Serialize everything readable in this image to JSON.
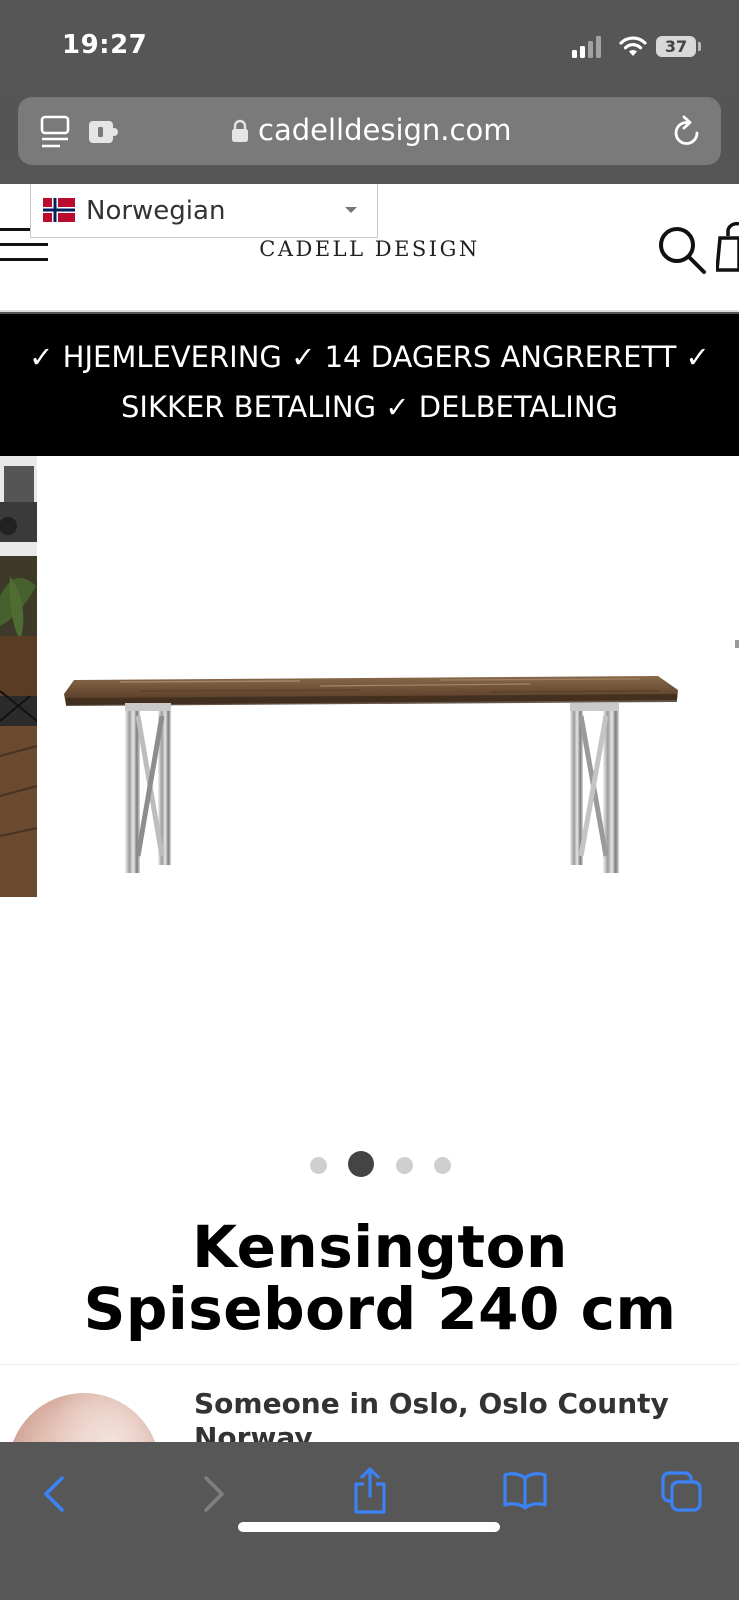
{
  "status_bar": {
    "time": "19:27",
    "battery": "37"
  },
  "browser": {
    "url": "cadelldesign.com",
    "icons": {
      "left1": "reader-icon",
      "left2": "extension-icon",
      "lock": "lock-icon",
      "reload": "reload-icon"
    }
  },
  "header": {
    "brand": "CADELL DESIGN",
    "language": {
      "selected": "Norwegian",
      "flag": "norway-flag-icon"
    }
  },
  "announcement": {
    "line1": "✓ HJEMLEVERING ✓ 14 DAGERS ANGRERETT ✓",
    "line2": "SIKKER BETALING ✓ DELBETALING"
  },
  "product": {
    "title": "Kensington Spisebord 240 cm",
    "gallery": {
      "slide_count": 4,
      "active_index": 1
    }
  },
  "popup": {
    "text": "Someone in Oslo, Oslo County Norway"
  },
  "toolbar": {
    "buttons": [
      "back-icon",
      "forward-icon",
      "share-icon",
      "bookmarks-icon",
      "tabs-icon"
    ]
  },
  "colors": {
    "browser_chrome": "#565656",
    "toolbar_accent": "#3b82f6",
    "announcement_bg": "#000000"
  }
}
